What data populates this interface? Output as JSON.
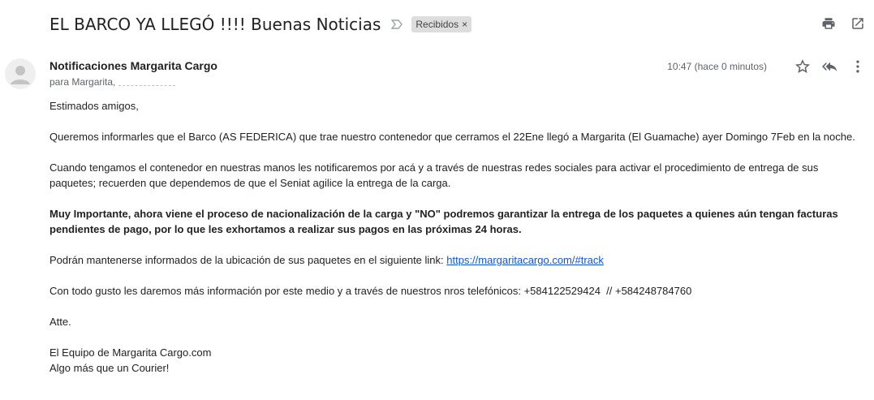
{
  "email": {
    "subject": "EL BARCO YA LLEGÓ !!!! Buenas Noticias",
    "label": "Recibidos",
    "label_close": "×",
    "sender": "Notificaciones Margarita Cargo",
    "recipient_prefix": "para Margarita, ",
    "timestamp": "10:47 (hace 0 minutos)"
  },
  "icons": {
    "importance": "importance-marker-icon",
    "print": "print-icon",
    "open_new_window": "open-in-new-window-icon",
    "star": "star-icon",
    "reply": "reply-all-icon",
    "more": "more-vert-icon",
    "avatar": "person-icon"
  },
  "body": {
    "greeting": "Estimados amigos,",
    "p1": "Queremos informarles que el Barco (AS FEDERICA) que trae nuestro contenedor que cerramos el 22Ene llegó a Margarita (El Guamache) ayer Domingo 7Feb en la noche.",
    "p2": "Cuando tengamos el contenedor en nuestras manos les notificaremos por acá y a través de nuestras redes sociales para activar el procedimiento de entrega de sus paquetes; recuerden que dependemos de que el Seniat agilice la entrega de la carga.",
    "p3": "Muy Importante, ahora viene el proceso de nacionalización de la carga y \"NO\" podremos garantizar la entrega de los paquetes a quienes aún tengan facturas pendientes de pago, por lo que les exhortamos a realizar sus pagos en las próximas 24 horas.",
    "p4_text": "Podrán mantenerse informados de la ubicación de sus paquetes en el siguiente link: ",
    "p4_link": "https://margaritacargo.com/#track",
    "p5": "Con todo gusto les daremos más información por este medio y a través de nuestros nros telefónicos: +584122529424  // +584248784760",
    "closing": "Atte.",
    "signature_line1": "El Equipo de Margarita Cargo.com",
    "signature_line2": "Algo más que un Courier!"
  }
}
